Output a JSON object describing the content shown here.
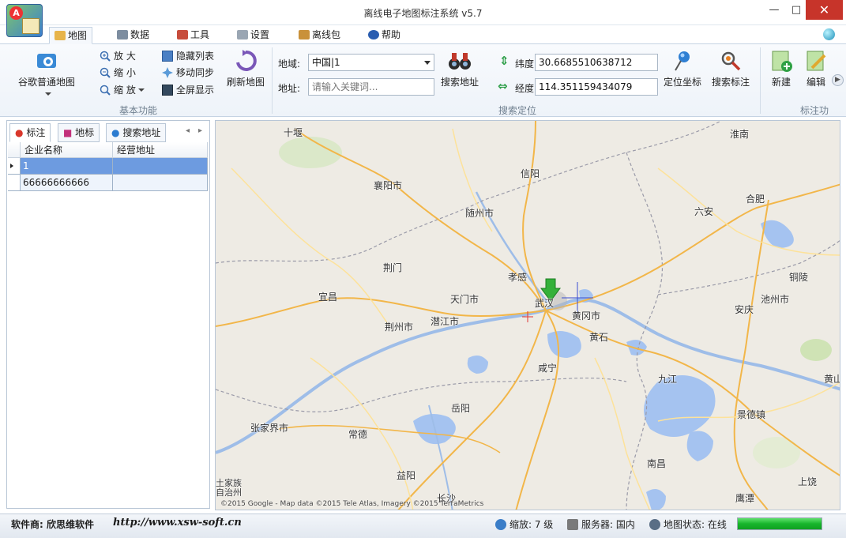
{
  "window": {
    "title": "离线电子地图标注系统 v5.7",
    "minimize": "—",
    "maximize": "□",
    "close": "✕"
  },
  "tabs": [
    {
      "label": "地图",
      "icon": "map-icon"
    },
    {
      "label": "数据",
      "icon": "data-icon"
    },
    {
      "label": "工具",
      "icon": "tools-icon"
    },
    {
      "label": "设置",
      "icon": "settings-icon"
    },
    {
      "label": "离线包",
      "icon": "package-icon"
    },
    {
      "label": "帮助",
      "icon": "help-icon"
    }
  ],
  "ribbon": {
    "basic": {
      "map_type_label": "谷歌普通地图",
      "zoom_in": "放 大",
      "zoom_out": "缩 小",
      "zoom": "缩 放",
      "hide_list": "隐藏列表",
      "move_sync": "移动同步",
      "fullscreen": "全屏显示",
      "refresh": "刷新地图",
      "group_label": "基本功能"
    },
    "search": {
      "region_label": "地域:",
      "region_value": "中国|1",
      "address_label": "地址:",
      "address_placeholder": "请输入关键词...",
      "search_address": "搜索地址",
      "lat_label": "纬度",
      "lat_value": "30.6685510638712",
      "lng_label": "经度",
      "lng_value": "114.351159434079",
      "locate": "定位坐标",
      "search_marker": "搜索标注",
      "group_label": "搜索定位"
    },
    "marker": {
      "new": "新建",
      "edit": "编辑",
      "group_label": "标注功"
    }
  },
  "panel": {
    "tabs": [
      "标注",
      "地标",
      "搜索地址"
    ],
    "nav_prev": "◂",
    "nav_next": "▸",
    "columns": [
      "企业名称",
      "经营地址"
    ],
    "rows": [
      {
        "name": "1",
        "address": ""
      },
      {
        "name": "66666666666",
        "address": ""
      }
    ]
  },
  "map": {
    "cities": [
      "十堰",
      "淮南",
      "信阳",
      "襄阳市",
      "合肥",
      "六安",
      "随州市",
      "荆门",
      "孝感",
      "铜陵",
      "宜昌",
      "天门市",
      "武汉",
      "黄冈市",
      "安庆",
      "池州市",
      "荆州市",
      "潜江市",
      "黄石",
      "咸宁",
      "九江",
      "黄山",
      "岳阳",
      "景德镇",
      "张家界市",
      "常德",
      "益阳",
      "南昌",
      "长沙",
      "上饶",
      "鹰潭",
      "土家族\n自治州"
    ],
    "copyright": "©2015 Google - Map data ©2015 Tele Atlas, Imagery ©2015 TerraMetrics",
    "colors": {
      "land": "#eeebe4",
      "water": "#a5c3f0",
      "road_major": "#f2b649",
      "road_minor": "#fde29a",
      "boundary": "#9a9aa8"
    }
  },
  "status": {
    "vendor": "软件商: 欣思维软件",
    "url": "http://www.xsw-soft.cn",
    "zoom": "缩放: 7 级",
    "server": "服务器: 国内",
    "map_state": "地图状态: 在线",
    "progress": 1.0
  }
}
